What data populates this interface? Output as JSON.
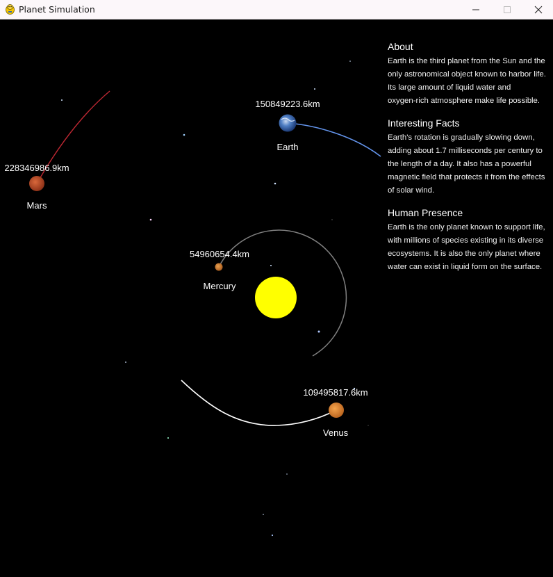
{
  "window": {
    "title": "Planet Simulation",
    "controls": [
      "minimize",
      "maximize",
      "close"
    ]
  },
  "colors": {
    "background": "#000000",
    "sun": "#ffff00",
    "mercury_orbit": "#808080",
    "venus_orbit": "#ffffff",
    "earth_orbit": "#6495ed",
    "mars_orbit": "#bc2732"
  },
  "planets": [
    {
      "id": "mercury",
      "name": "Mercury",
      "distance": "54960654.4km",
      "color": "#c8782a"
    },
    {
      "id": "venus",
      "name": "Venus",
      "distance": "109495817.6km",
      "color": "#d9822b"
    },
    {
      "id": "earth",
      "name": "Earth",
      "distance": "150849223.6km",
      "color": "#2f5b9e"
    },
    {
      "id": "mars",
      "name": "Mars",
      "distance": "228346986.9km",
      "color": "#b5472a"
    }
  ],
  "info_panel": {
    "sections": [
      {
        "heading": "About",
        "lines": [
          "Earth is the third planet from the Sun and the",
          "only astronomical object known to harbor life.",
          "Its large amount of liquid water and",
          "oxygen-rich atmosphere make life possible."
        ]
      },
      {
        "heading": "Interesting Facts",
        "lines": [
          "Earth's rotation is gradually slowing down,",
          "adding about 1.7 milliseconds per century to",
          "the length of a day. It also has a powerful",
          "magnetic field that protects it from the effects",
          "of solar wind."
        ]
      },
      {
        "heading": "Human Presence",
        "lines": [
          "Earth is the only planet known to support life,",
          "with millions of species existing in its diverse",
          "ecosystems. It is also the only planet where",
          "water can exist in liquid form on the surface."
        ]
      }
    ]
  }
}
